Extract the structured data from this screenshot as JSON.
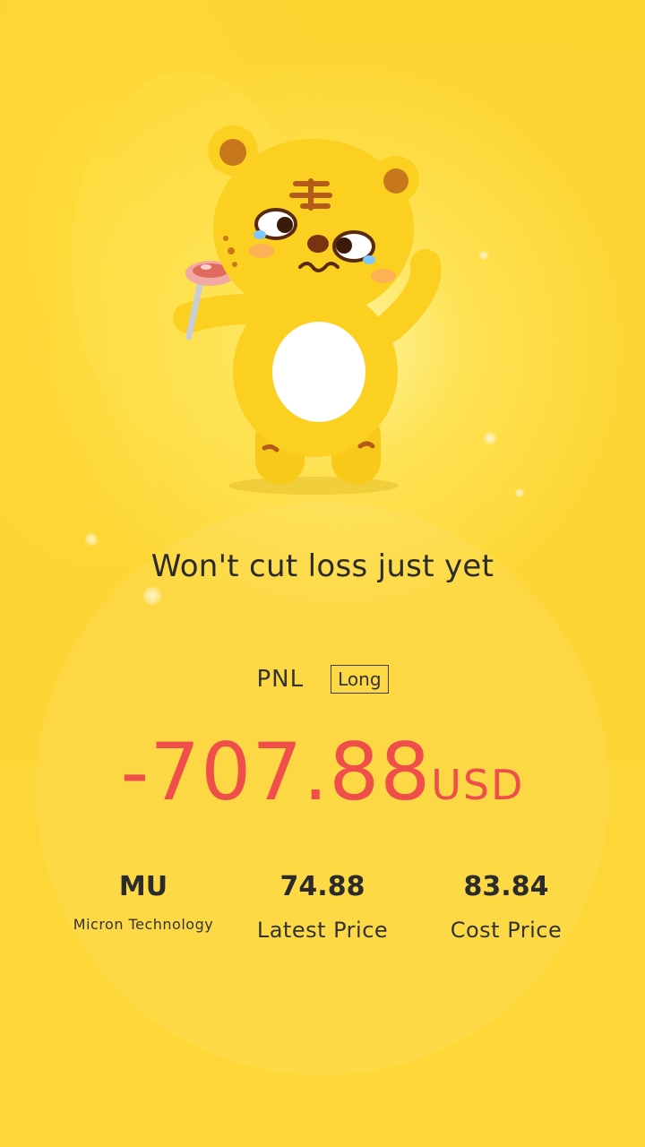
{
  "headline": "Won't cut loss just yet",
  "pnl": {
    "label": "PNL",
    "position_tag": "Long",
    "amount": "-707.88",
    "currency": "USD",
    "amount_color": "#f04e4a"
  },
  "stock": {
    "ticker": "MU",
    "name": "Micron Technology"
  },
  "latest_price": {
    "value": "74.88",
    "label": "Latest Price"
  },
  "cost_price": {
    "value": "83.84",
    "label": "Cost Price"
  },
  "colors": {
    "background": "#fdd634",
    "loss": "#f04e4a",
    "text": "#2b2b2b"
  },
  "illustration": "crying-tiger-mascot-holding-steak"
}
